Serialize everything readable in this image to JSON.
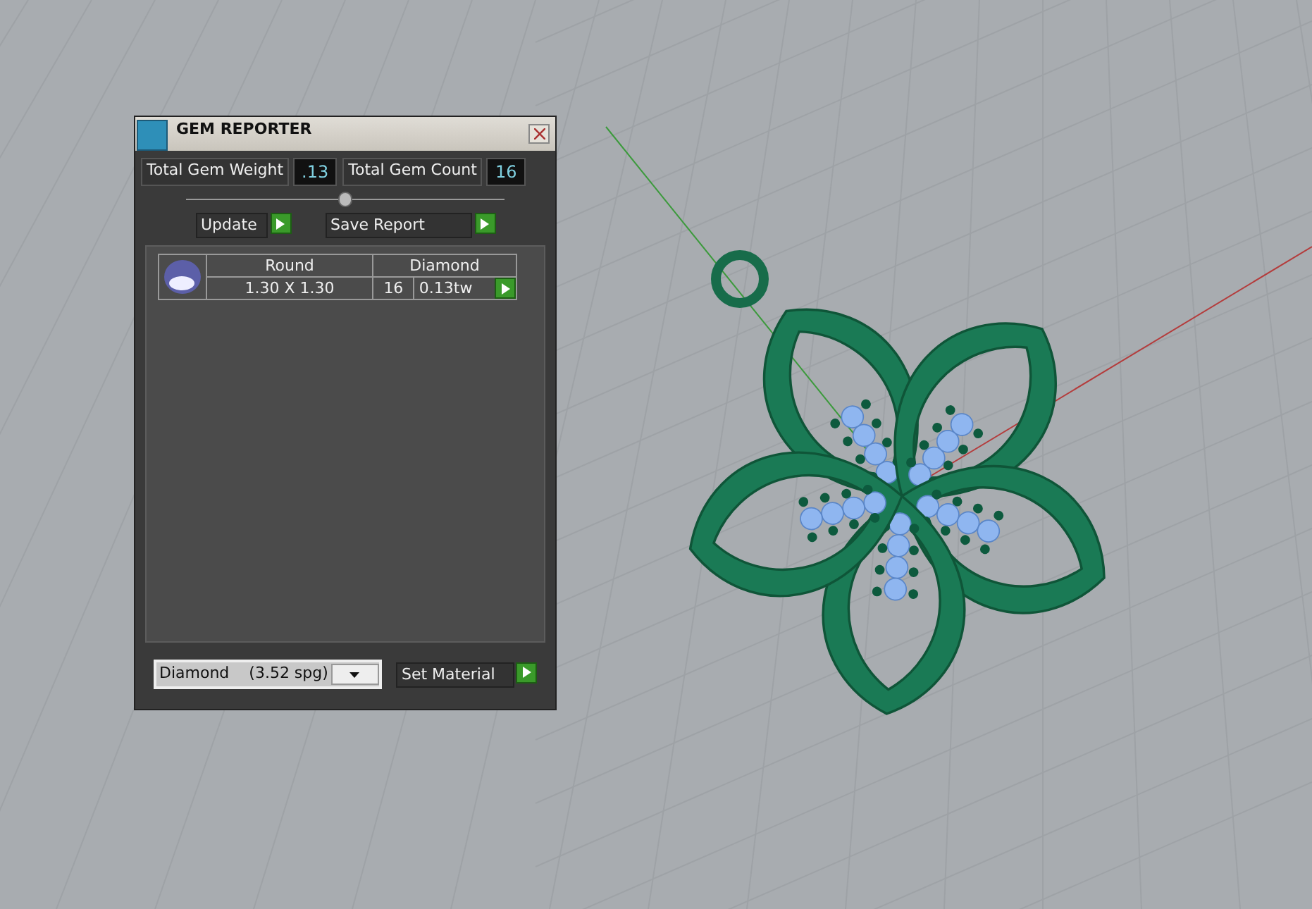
{
  "window": {
    "title": "GEM REPORTER"
  },
  "totals": [
    {
      "label": "Total Gem Weight",
      "value": ".13"
    },
    {
      "label": "Total Gem Count",
      "value": "16"
    }
  ],
  "buttons": [
    {
      "label": "Update"
    },
    {
      "label": "Save Report"
    }
  ],
  "gems": [
    {
      "shape": "Round",
      "material": "Diamond",
      "size": "1.30 X 1.30",
      "count": "16",
      "weight": "0.13tw"
    }
  ],
  "material_select": {
    "value": "Diamond    (3.52 spg)"
  },
  "set_material_button": {
    "label": "Set Material"
  }
}
